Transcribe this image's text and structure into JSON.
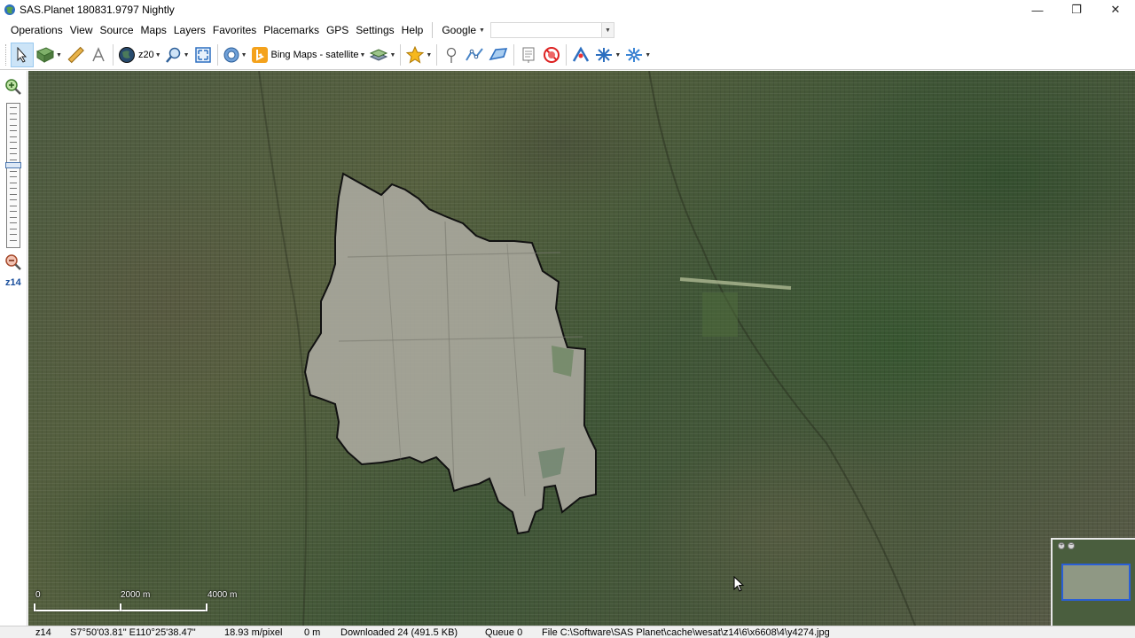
{
  "window": {
    "title": "SAS.Planet 180831.9797 Nightly",
    "buttons": {
      "minimize": "—",
      "maximize": "❐",
      "close": "✕"
    }
  },
  "menu": {
    "items": [
      "Operations",
      "View",
      "Source",
      "Maps",
      "Layers",
      "Favorites",
      "Placemarks",
      "GPS",
      "Settings",
      "Help"
    ],
    "search_provider": "Google",
    "search_value": ""
  },
  "toolbar": {
    "zoom_level": "z20",
    "map_source": "Bing Maps - satellite",
    "icons": [
      "cursor-icon",
      "select-area-icon",
      "ruler-icon",
      "path-icon",
      "globe-icon",
      "zoom-icon",
      "fullscreen-icon",
      "gps-icon",
      "bing-icon",
      "layers-icon",
      "favorites-star-icon",
      "placemark-pin-icon",
      "polyline-icon",
      "polygon-icon",
      "marks-list-icon",
      "hide-marks-icon",
      "gps-track-icon",
      "gps-connect-icon",
      "gps-settings-icon"
    ]
  },
  "left_panel": {
    "zoom_label": "z14"
  },
  "map": {
    "scale": {
      "zero": "0",
      "mid": "2000 m",
      "end": "4000 m"
    },
    "colors": {
      "region_fill": "#a8a79c",
      "region_border": "#111111",
      "minimap_view": "#2a5fd6"
    }
  },
  "status": {
    "zoom": "z14",
    "coordinates": "S7°50'03.81\" E110°25'38.47\"",
    "resolution": "18.93 m/pixel",
    "elevation": "0 m",
    "downloaded": "Downloaded 24 (491.5 KB)",
    "queue": "Queue 0",
    "file": "File C:\\Software\\SAS Planet\\cache\\wesat\\z14\\6\\x6608\\4\\y4274.jpg"
  }
}
